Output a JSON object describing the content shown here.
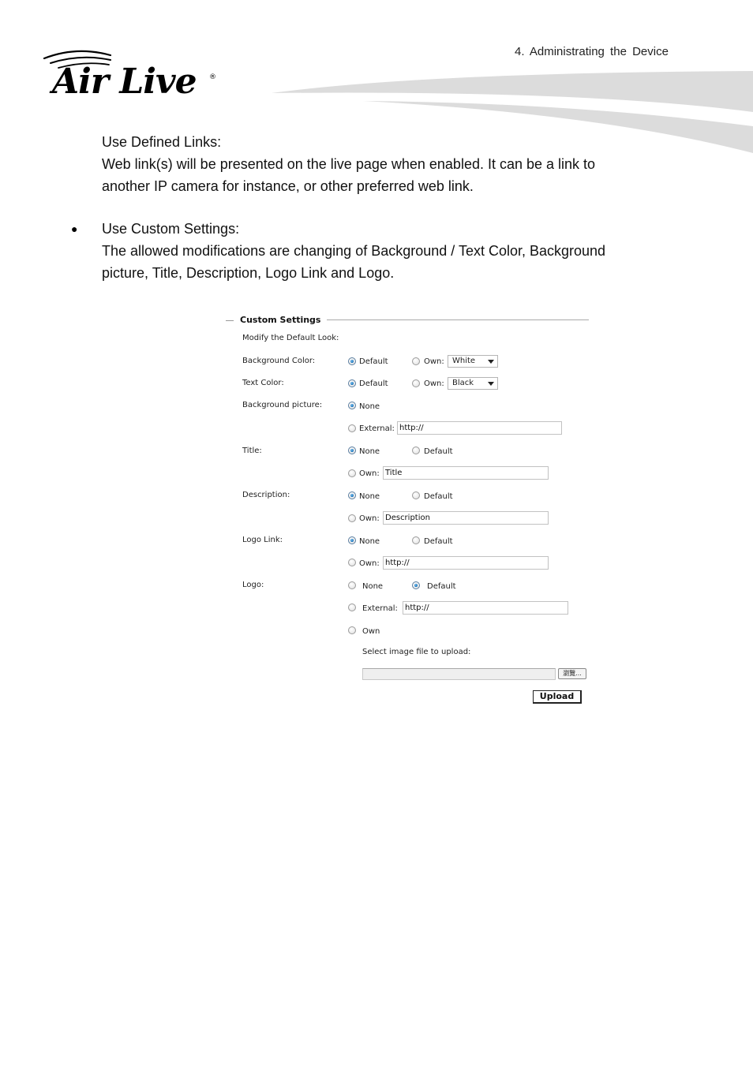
{
  "header": {
    "brand": "Air Live",
    "chapter": "4. Administrating the Device"
  },
  "body": {
    "section1_title": "Use Defined Links:",
    "section1_line1": "Web link(s) will be presented on the live page when enabled. It can be a link to",
    "section1_line2": "another IP camera for instance, or other preferred web link.",
    "bullet": "●",
    "section2_title": "Use Custom Settings:",
    "section2_line1": "The allowed modifications are changing of Background / Text Color, Background",
    "section2_line2": "picture, Title, Description, Logo Link and Logo."
  },
  "form": {
    "legend": "Custom Settings",
    "intro": "Modify the Default Look:",
    "background_color": {
      "label": "Background Color:",
      "options": [
        "Default",
        "Own:"
      ],
      "selected": "Default",
      "own_value": "White"
    },
    "text_color": {
      "label": "Text Color:",
      "options": [
        "Default",
        "Own:"
      ],
      "selected": "Default",
      "own_value": "Black"
    },
    "background_picture": {
      "label": "Background picture:",
      "options": [
        "None",
        "External:"
      ],
      "selected": "None",
      "external_value": "http://"
    },
    "title": {
      "label": "Title:",
      "options": [
        "None",
        "Default",
        "Own:"
      ],
      "selected": "None",
      "own_value": "Title"
    },
    "description": {
      "label": "Description:",
      "options": [
        "None",
        "Default",
        "Own:"
      ],
      "selected": "None",
      "own_value": "Description"
    },
    "logo_link": {
      "label": "Logo Link:",
      "options": [
        "None",
        "Default",
        "Own:"
      ],
      "selected": "None",
      "own_value": "http://"
    },
    "logo": {
      "label": "Logo:",
      "options": [
        "None",
        "Default",
        "External:",
        "Own"
      ],
      "selected": "Default",
      "external_value": "http://",
      "upload_prompt": "Select image file to upload:",
      "file_value": "",
      "browse_label": "瀏覽...",
      "upload_label": "Upload"
    }
  },
  "colors": {
    "radio_checked": "#1670b8",
    "swoosh": "#dcdcdc"
  }
}
